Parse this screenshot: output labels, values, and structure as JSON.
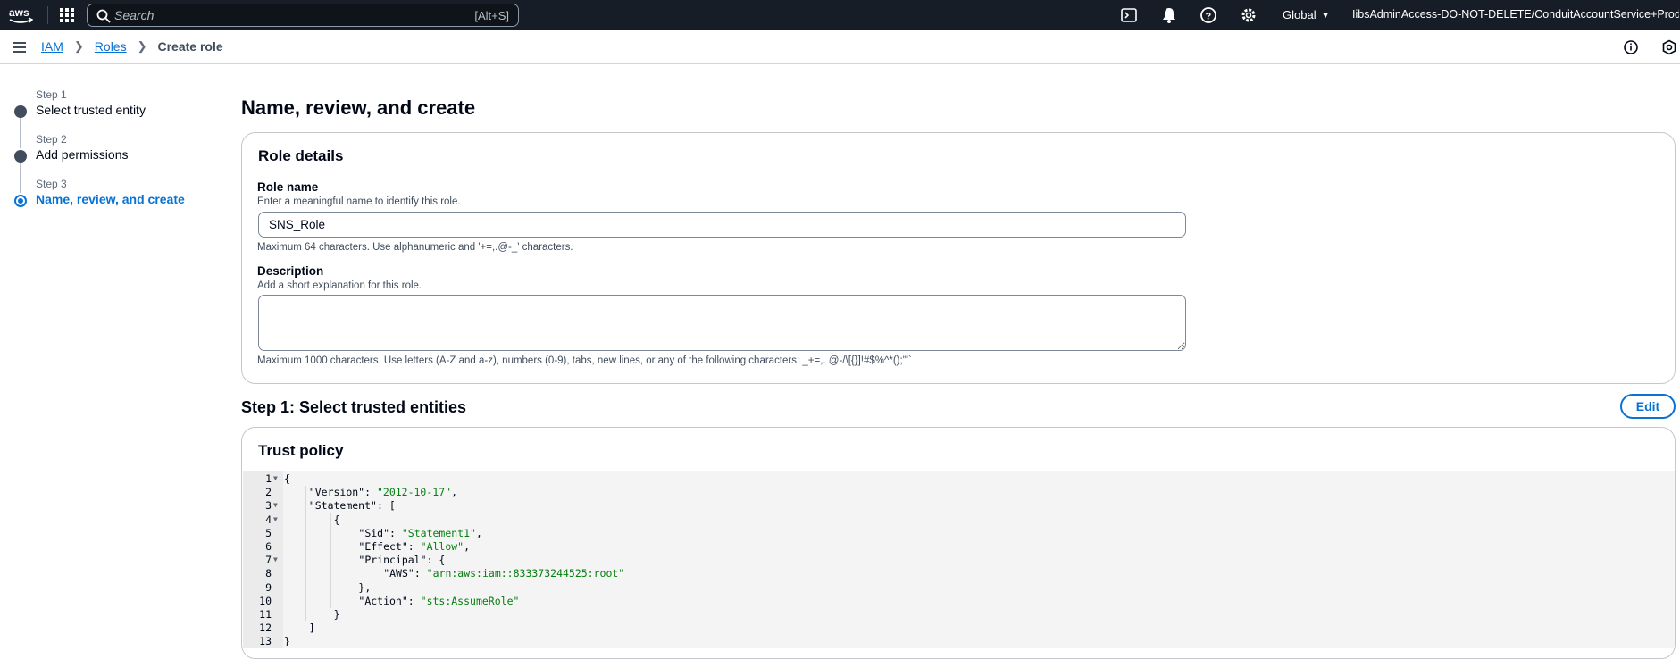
{
  "topnav": {
    "logo": "aws",
    "search_placeholder": "Search",
    "search_shortcut": "[Alt+S]",
    "region": "Global",
    "account": "IibsAdminAccess-DO-NOT-DELETE/ConduitAccountService+Prod+Defa...",
    "icons": [
      "cloudshell-icon",
      "bell-icon",
      "help-icon",
      "settings-icon"
    ]
  },
  "breadcrumb": {
    "items": [
      "IAM",
      "Roles"
    ],
    "current": "Create role"
  },
  "steps": [
    {
      "num": "Step 1",
      "title": "Select trusted entity",
      "state": "done"
    },
    {
      "num": "Step 2",
      "title": "Add permissions",
      "state": "done"
    },
    {
      "num": "Step 3",
      "title": "Name, review, and create",
      "state": "active"
    }
  ],
  "main": {
    "title": "Name, review, and create",
    "role_details": {
      "title": "Role details",
      "role_name_label": "Role name",
      "role_name_desc": "Enter a meaningful name to identify this role.",
      "role_name_value": "SNS_Role",
      "role_name_constraint": "Maximum 64 characters. Use alphanumeric and '+=,.@-_' characters.",
      "description_label": "Description",
      "description_desc": "Add a short explanation for this role.",
      "description_value": "",
      "description_constraint": "Maximum 1000 characters. Use letters (A-Z and a-z), numbers (0-9), tabs, new lines, or any of the following characters: _+=,. @-/\\[{}]!#$%^*();\"'`"
    },
    "step1": {
      "heading": "Step 1: Select trusted entities",
      "edit_label": "Edit",
      "trust_policy_title": "Trust policy"
    }
  },
  "code": [
    {
      "n": "1",
      "fold": true,
      "indent": 0,
      "text": "{"
    },
    {
      "n": "2",
      "fold": false,
      "indent": 1,
      "key": "\"Version\"",
      "val": "\"2012-10-17\"",
      "tail": ","
    },
    {
      "n": "3",
      "fold": true,
      "indent": 1,
      "key": "\"Statement\"",
      "tail": ": ["
    },
    {
      "n": "4",
      "fold": true,
      "indent": 2,
      "text": "{"
    },
    {
      "n": "5",
      "fold": false,
      "indent": 3,
      "key": "\"Sid\"",
      "val": "\"Statement1\"",
      "tail": ","
    },
    {
      "n": "6",
      "fold": false,
      "indent": 3,
      "key": "\"Effect\"",
      "val": "\"Allow\"",
      "tail": ","
    },
    {
      "n": "7",
      "fold": true,
      "indent": 3,
      "key": "\"Principal\"",
      "tail": ": {"
    },
    {
      "n": "8",
      "fold": false,
      "indent": 4,
      "key": "\"AWS\"",
      "val": "\"arn:aws:iam::833373244525:root\"",
      "tail": ""
    },
    {
      "n": "9",
      "fold": false,
      "indent": 3,
      "text": "},"
    },
    {
      "n": "10",
      "fold": false,
      "indent": 3,
      "key": "\"Action\"",
      "val": "\"sts:AssumeRole\"",
      "tail": ""
    },
    {
      "n": "11",
      "fold": false,
      "indent": 2,
      "text": "}"
    },
    {
      "n": "12",
      "fold": false,
      "indent": 1,
      "text": "]"
    },
    {
      "n": "13",
      "fold": false,
      "indent": 0,
      "text": "}"
    }
  ]
}
